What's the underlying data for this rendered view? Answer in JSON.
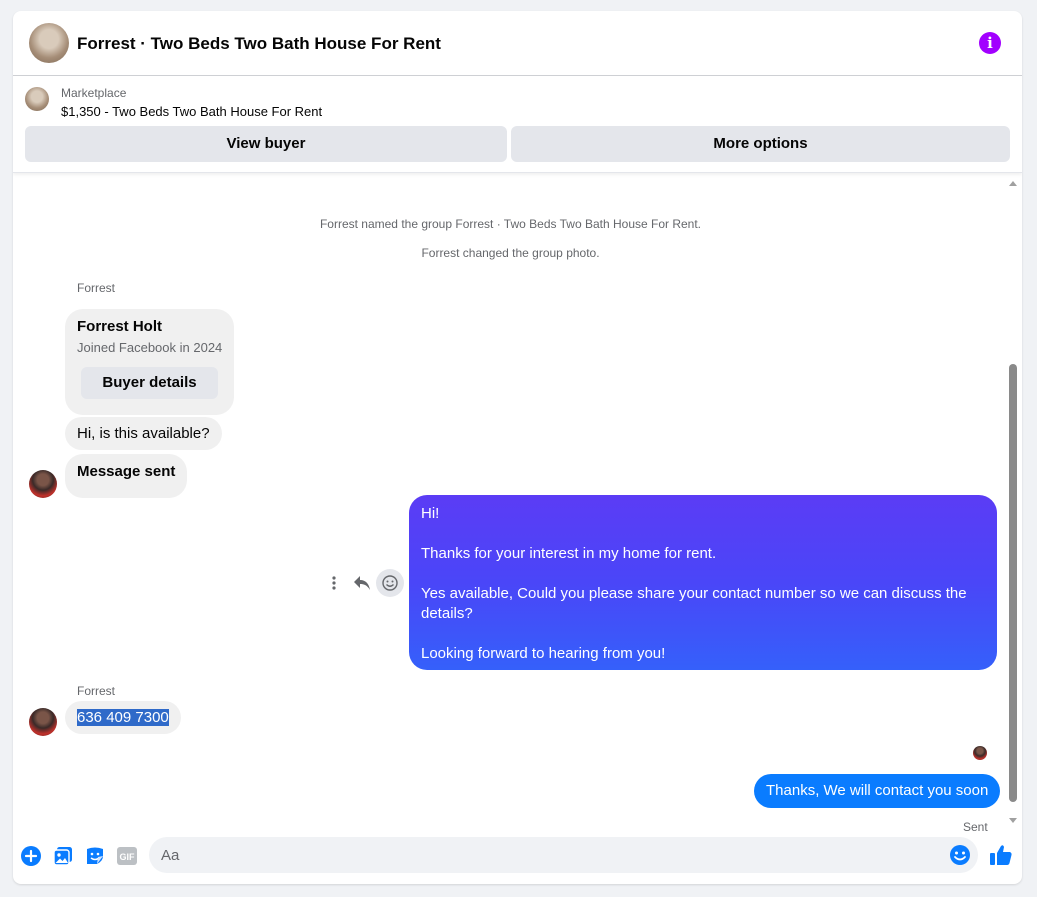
{
  "header": {
    "title": "Forrest · Two Beds Two Bath House For Rent",
    "info_icon": "info-icon",
    "info_glyph": "i"
  },
  "product": {
    "category": "Marketplace",
    "listing": "$1,350 - Two Beds Two Bath House For Rent",
    "view_buyer_label": "View buyer",
    "more_options_label": "More options"
  },
  "conversation": {
    "system_messages": [
      "Forrest named the group Forrest · Two Beds Two Bath House For Rent.",
      "Forrest changed the group photo."
    ],
    "buyer_card": {
      "sender": "Forrest",
      "name": "Forrest Holt",
      "joined": "Joined Facebook in 2024",
      "button_label": "Buyer details"
    },
    "incoming": [
      "Hi, is this available?",
      "Message sent"
    ],
    "outgoing_long": {
      "lines": [
        "Hi!",
        "Thanks for your interest in my home for rent.",
        "Yes available, Could you please share your contact number so we can discuss the details?",
        "Looking forward to hearing from you!"
      ]
    },
    "reply_sender": "Forrest",
    "reply_text": "636 409 7300",
    "outgoing_short": "Thanks, We will contact you soon",
    "status": "Sent"
  },
  "composer": {
    "placeholder": "Aa",
    "gif_label": "GIF"
  },
  "colors": {
    "accent": "#0a7cff",
    "info": "#a200ff",
    "gradient_top": "#5b3cf5",
    "gradient_bottom": "#3560fa"
  }
}
